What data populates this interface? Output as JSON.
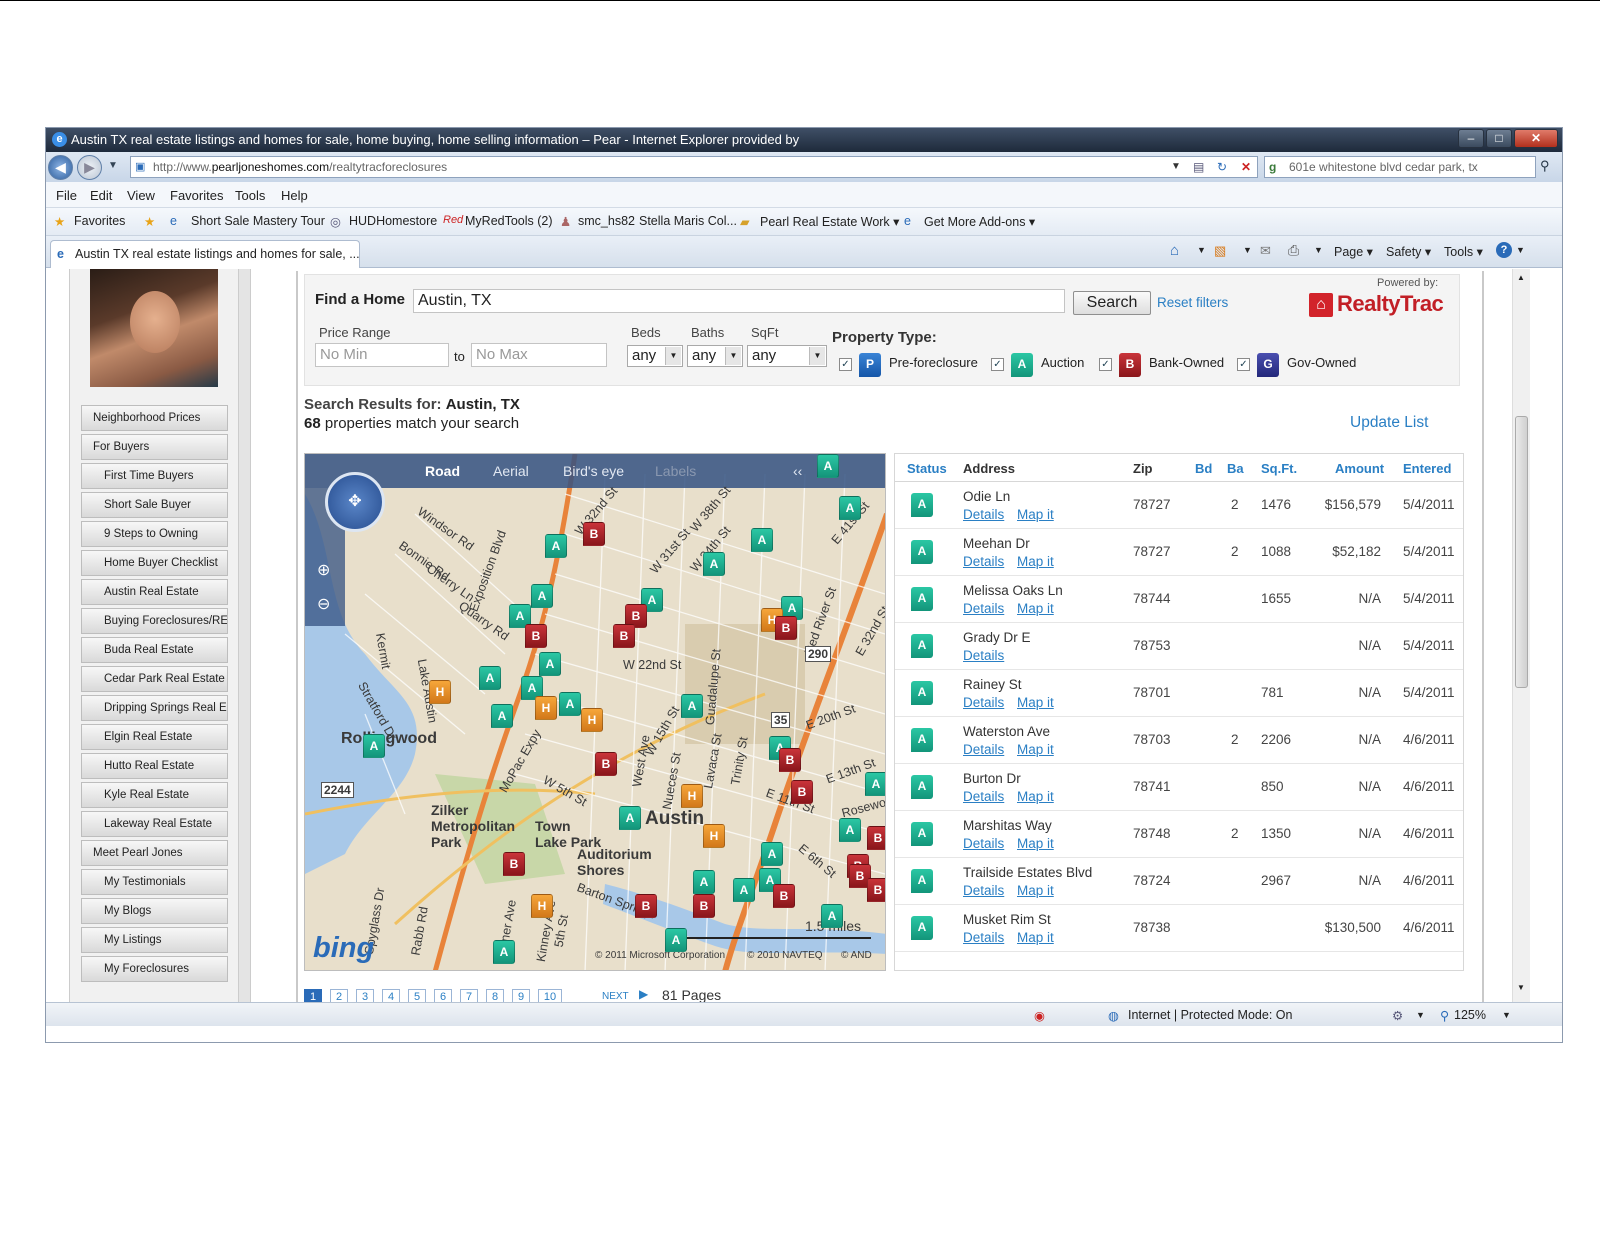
{
  "window": {
    "title": "Austin TX real estate listings and homes for sale, home buying, home selling information – Pear - Internet Explorer provided by",
    "minimize": "–",
    "maximize": "□",
    "close": "✕"
  },
  "address_bar": {
    "url_prefix": "http://www.",
    "url_domain": "pearljoneshomes.com",
    "url_path": "/realtytracforeclosures",
    "search_text": "601e whitestone blvd cedar park, tx"
  },
  "menu": [
    "File",
    "Edit",
    "View",
    "Favorites",
    "Tools",
    "Help"
  ],
  "favorites_bar": {
    "favorites_label": "Favorites",
    "items": [
      "Short Sale Mastery Tour",
      "HUDHomestore",
      "MyRedTools (2)",
      "smc_hs82",
      "Stella Maris Col...",
      "Pearl Real Estate Work ▾",
      "Get More Add-ons ▾"
    ]
  },
  "tab": {
    "title": "Austin TX real estate listings and homes for sale, ..."
  },
  "command_bar": [
    "Page ▾",
    "Safety ▾",
    "Tools ▾"
  ],
  "sidebar": {
    "items": [
      {
        "label": "Neighborhood Prices",
        "level": "top"
      },
      {
        "label": "For Buyers",
        "level": "top"
      },
      {
        "label": "First Time Buyers",
        "level": "sub"
      },
      {
        "label": "Short Sale Buyer",
        "level": "sub"
      },
      {
        "label": "9 Steps to Owning",
        "level": "sub"
      },
      {
        "label": "Home Buyer Checklist",
        "level": "sub"
      },
      {
        "label": "Austin Real Estate",
        "level": "sub"
      },
      {
        "label": "Buying Foreclosures/RE",
        "level": "sub"
      },
      {
        "label": "Buda Real Estate",
        "level": "sub"
      },
      {
        "label": "Cedar Park Real Estate",
        "level": "sub"
      },
      {
        "label": "Dripping Springs Real E",
        "level": "sub"
      },
      {
        "label": "Elgin Real Estate",
        "level": "sub"
      },
      {
        "label": "Hutto Real Estate",
        "level": "sub"
      },
      {
        "label": "Kyle Real Estate",
        "level": "sub"
      },
      {
        "label": "Lakeway Real Estate",
        "level": "sub"
      },
      {
        "label": "Meet Pearl Jones",
        "level": "top"
      },
      {
        "label": "My Testimonials",
        "level": "sub"
      },
      {
        "label": "My Blogs",
        "level": "sub"
      },
      {
        "label": "My Listings",
        "level": "sub"
      },
      {
        "label": "My Foreclosures",
        "level": "sub"
      }
    ]
  },
  "search": {
    "find_label": "Find a Home",
    "find_value": "Austin, TX",
    "search_button": "Search",
    "reset_link": "Reset filters",
    "powered_by": "Powered by:",
    "brand": "RealtyTrac",
    "price_label": "Price Range",
    "min_placeholder": "No Min",
    "to_label": "to",
    "max_placeholder": "No Max",
    "beds_label": "Beds",
    "baths_label": "Baths",
    "sqft_label": "SqFt",
    "beds_value": "any",
    "baths_value": "any",
    "sqft_value": "any",
    "property_type_label": "Property Type:",
    "types": [
      {
        "code": "P",
        "label": "Pre-foreclosure"
      },
      {
        "code": "A",
        "label": "Auction"
      },
      {
        "code": "B",
        "label": "Bank-Owned"
      },
      {
        "code": "G",
        "label": "Gov-Owned"
      }
    ]
  },
  "results": {
    "heading_prefix": "Search Results for:",
    "heading_place": "Austin, TX",
    "count": "68",
    "count_suffix": "properties match your search",
    "update_link": "Update List"
  },
  "map": {
    "tabs": [
      "Road",
      "Aerial",
      "Bird's eye",
      "Labels",
      "‹‹"
    ],
    "labels": [
      "W 38th St",
      "W 34th St",
      "W 32nd St",
      "W 31st St",
      "E 41st St",
      "Windsor Rd",
      "Bonnie Rd",
      "Cherry Ln",
      "Exposition Blvd",
      "Quarry Rd",
      "W 22nd St",
      "Guadalupe St",
      "Red River St",
      "E 32nd St",
      "E 20th St",
      "W 15th St",
      "W 5th St",
      "E 11th St",
      "E 13th St",
      "E 6th St",
      "Rosewood",
      "Chestnut Ave",
      "Kermit",
      "Lake Austin",
      "Stratford Dr",
      "MoPac Expy",
      "Barton Springs",
      "Spyglass Dr",
      "Rabb Rd",
      "Garner Ave",
      "Kinney Ave",
      "5th St",
      "Lavaca St",
      "Trinity St",
      "Nueces St",
      "West Ave",
      "Rollingwood",
      "Zilker Metropolitan Park",
      "Town Lake Park",
      "Auditorium Shores",
      "Austin",
      "290",
      "35",
      "2244",
      "1.5 miles",
      "© 2011 Microsoft Corporation",
      "© 2010 NAVTEQ",
      "© AND",
      "bing"
    ],
    "scale": "1.5 miles"
  },
  "table": {
    "headers": [
      "Status",
      "Address",
      "Zip",
      "Bd",
      "Ba",
      "Sq.Ft.",
      "Amount",
      "Entered"
    ],
    "details_label": "Details",
    "mapit_label": "Map it",
    "rows": [
      {
        "status": "A",
        "address": "Odie Ln",
        "zip": "78727",
        "bd": "",
        "ba": "2",
        "sqft": "1476",
        "amount": "$156,579",
        "entered": "5/4/2011",
        "mapit": true
      },
      {
        "status": "A",
        "address": "Meehan Dr",
        "zip": "78727",
        "bd": "",
        "ba": "2",
        "sqft": "1088",
        "amount": "$52,182",
        "entered": "5/4/2011",
        "mapit": true
      },
      {
        "status": "A",
        "address": "Melissa Oaks Ln",
        "zip": "78744",
        "bd": "",
        "ba": "",
        "sqft": "1655",
        "amount": "N/A",
        "entered": "5/4/2011",
        "mapit": true
      },
      {
        "status": "A",
        "address": "Grady Dr E",
        "zip": "78753",
        "bd": "",
        "ba": "",
        "sqft": "",
        "amount": "N/A",
        "entered": "5/4/2011",
        "mapit": false
      },
      {
        "status": "A",
        "address": "Rainey St",
        "zip": "78701",
        "bd": "",
        "ba": "",
        "sqft": "781",
        "amount": "N/A",
        "entered": "5/4/2011",
        "mapit": true
      },
      {
        "status": "A",
        "address": "Waterston Ave",
        "zip": "78703",
        "bd": "",
        "ba": "2",
        "sqft": "2206",
        "amount": "N/A",
        "entered": "4/6/2011",
        "mapit": true
      },
      {
        "status": "A",
        "address": "Burton Dr",
        "zip": "78741",
        "bd": "",
        "ba": "",
        "sqft": "850",
        "amount": "N/A",
        "entered": "4/6/2011",
        "mapit": true
      },
      {
        "status": "A",
        "address": "Marshitas Way",
        "zip": "78748",
        "bd": "",
        "ba": "2",
        "sqft": "1350",
        "amount": "N/A",
        "entered": "4/6/2011",
        "mapit": true
      },
      {
        "status": "A",
        "address": "Trailside Estates Blvd",
        "zip": "78724",
        "bd": "",
        "ba": "",
        "sqft": "2967",
        "amount": "N/A",
        "entered": "4/6/2011",
        "mapit": true
      },
      {
        "status": "A",
        "address": "Musket Rim St",
        "zip": "78738",
        "bd": "",
        "ba": "",
        "sqft": "",
        "amount": "$130,500",
        "entered": "4/6/2011",
        "mapit": true
      }
    ]
  },
  "pager": {
    "pages": [
      "1",
      "2",
      "3",
      "4",
      "5",
      "6",
      "7",
      "8",
      "9",
      "10"
    ],
    "next": "NEXT",
    "total": "81 Pages"
  },
  "status_bar": {
    "zone": "Internet | Protected Mode: On",
    "zoom": "125%"
  },
  "colors": {
    "auction": "#13957a",
    "bank_owned": "#8a161b",
    "pre_foreclosure": "#1556a8",
    "gov_owned": "#23287a",
    "link": "#2a7fc4"
  }
}
